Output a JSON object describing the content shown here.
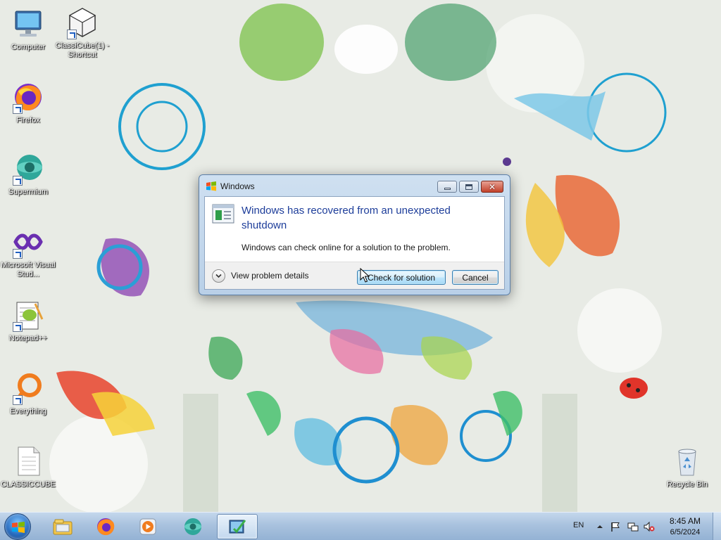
{
  "desktop": {
    "icons": [
      {
        "name": "computer-icon",
        "label": "Computer"
      },
      {
        "name": "classicube-shortcut-icon",
        "label": "ClassiCube(1) - Shortcut"
      },
      {
        "name": "firefox-icon",
        "label": "Firefox"
      },
      {
        "name": "supermium-icon",
        "label": "Supermium"
      },
      {
        "name": "visual-studio-icon",
        "label": "Microsoft Visual Stud..."
      },
      {
        "name": "notepadpp-icon",
        "label": "Notepad++"
      },
      {
        "name": "everything-icon",
        "label": "Everything"
      },
      {
        "name": "classicube-file-icon",
        "label": "CLASSICCUBE"
      },
      {
        "name": "recycle-bin-icon",
        "label": "Recycle Bin"
      }
    ]
  },
  "dialog": {
    "title": "Windows",
    "main_instruction": "Windows has recovered from an unexpected shutdown",
    "content_text": "Windows can check online for a solution to the problem.",
    "details_label": "View problem details",
    "check_button": "Check for solution",
    "cancel_button": "Cancel"
  },
  "taskbar": {
    "apps": [
      "windows-explorer-icon",
      "firefox-icon",
      "media-player-icon",
      "supermium-icon",
      "problem-reporting-icon"
    ],
    "language": "EN",
    "time": "8:45 AM",
    "date": "6/5/2024"
  }
}
